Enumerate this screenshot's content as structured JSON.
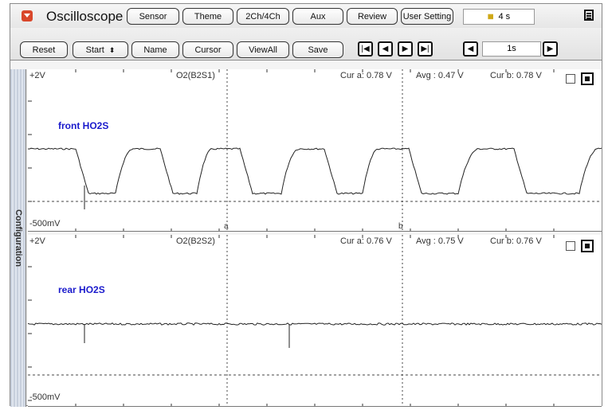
{
  "app": {
    "title": "Oscilloscope"
  },
  "top_tabs": [
    "Sensor",
    "Theme",
    "2Ch/4Ch",
    "Aux",
    "Review",
    "User Setting"
  ],
  "time_display": {
    "value": "4 s"
  },
  "toolbar": {
    "buttons": [
      "Reset",
      "Start",
      "Name",
      "Cursor",
      "ViewAll",
      "Save"
    ],
    "time_step": "1s"
  },
  "sidebar": {
    "label": "Configuration"
  },
  "channels": [
    {
      "name": "O2(B2S1)",
      "label": "front HO2S",
      "y_max": "+2V",
      "y_min": "-500mV",
      "cur_a": "Cur a: 0.78 V",
      "avg": "Avg  : 0.47 V",
      "cur_b": "Cur b: 0.78 V",
      "cursor_a": "a",
      "cursor_b": "b"
    },
    {
      "name": "O2(B2S2)",
      "label": "rear HO2S",
      "y_max": "+2V",
      "y_min": "-500mV",
      "cur_a": "Cur a: 0.76 V",
      "avg": "Avg  : 0.75 V",
      "cur_b": "Cur b: 0.76 V"
    }
  ],
  "colors": {
    "accent": "#d9472b",
    "label": "#1a1acc",
    "trace": "#222222"
  }
}
